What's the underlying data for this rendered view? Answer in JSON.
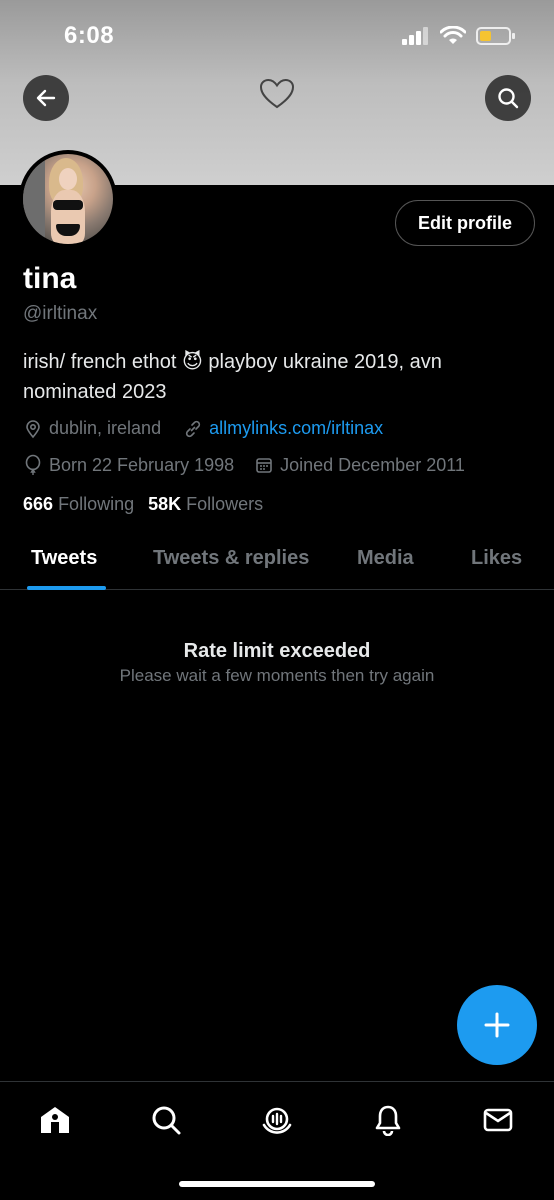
{
  "status": {
    "time": "6:08"
  },
  "profile": {
    "name": "tina",
    "handle": "@irltinax",
    "bio": "irish/ french ethot 😈 playboy ukraine 2019, avn nominated 2023",
    "location": "dublin, ireland",
    "link": "allmylinks.com/irltinax",
    "born": "Born 22 February 1998",
    "joined": "Joined December 2011",
    "following_count": "666",
    "following_label": "Following",
    "followers_count": "58K",
    "followers_label": "Followers",
    "edit_label": "Edit profile"
  },
  "tabs": [
    {
      "label": "Tweets",
      "active": true
    },
    {
      "label": "Tweets & replies",
      "active": false
    },
    {
      "label": "Media",
      "active": false
    },
    {
      "label": "Likes",
      "active": false
    }
  ],
  "feed": {
    "error_title": "Rate limit exceeded",
    "error_subtitle": "Please wait a few moments then try again"
  },
  "bottom_nav": [
    "home-icon",
    "search-icon",
    "spaces-icon",
    "notifications-icon",
    "messages-icon"
  ],
  "colors": {
    "accent": "#1d9bf0",
    "background": "#000000",
    "muted": "#71767b"
  }
}
